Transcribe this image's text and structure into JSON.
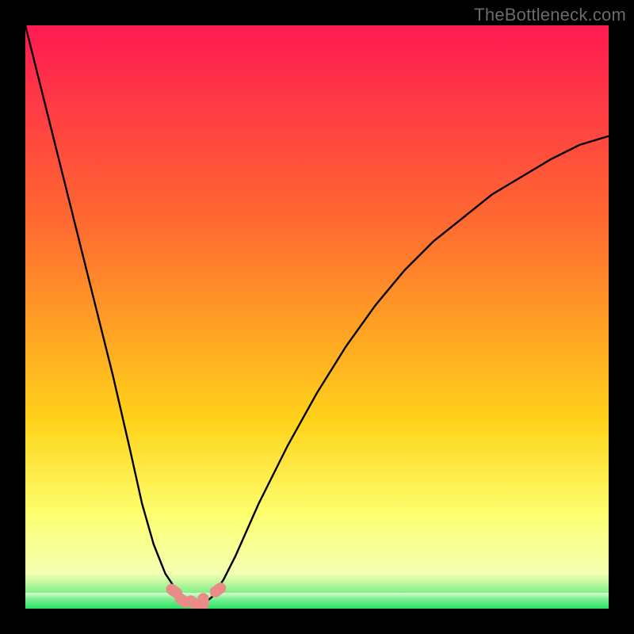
{
  "watermark": "TheBottleneck.com",
  "colors": {
    "frame": "#000000",
    "gradient_top": "#ff1a52",
    "gradient_mid1": "#ff6d2f",
    "gradient_mid2": "#ffd31a",
    "gradient_low": "#fdff70",
    "gradient_pale": "#f3ffb3",
    "green": "#29e165",
    "curve": "#000000",
    "marker": "#e98b87"
  },
  "chart_data": {
    "type": "line",
    "title": "",
    "xlabel": "",
    "ylabel": "",
    "xlim": [
      0,
      100
    ],
    "ylim": [
      0,
      100
    ],
    "series": [
      {
        "name": "bottleneck-curve",
        "x": [
          0,
          5,
          10,
          15,
          18,
          20,
          22,
          24,
          26,
          27,
          28,
          29,
          30,
          31,
          32,
          34,
          36,
          40,
          45,
          50,
          55,
          60,
          65,
          70,
          75,
          80,
          85,
          90,
          95,
          100
        ],
        "y": [
          100,
          80,
          60,
          40,
          27,
          18,
          11,
          6,
          3,
          1.5,
          1,
          1,
          1,
          1.2,
          2,
          5,
          9,
          18,
          28,
          37,
          45,
          52,
          58,
          63,
          67,
          71,
          74,
          77,
          79.5,
          81
        ]
      }
    ],
    "markers": [
      {
        "x": 25.5,
        "y": 3.0
      },
      {
        "x": 27.0,
        "y": 1.4
      },
      {
        "x": 28.8,
        "y": 1.0
      },
      {
        "x": 30.5,
        "y": 1.2
      },
      {
        "x": 33.0,
        "y": 3.2
      }
    ],
    "green_band_y": [
      0,
      2.2
    ]
  }
}
